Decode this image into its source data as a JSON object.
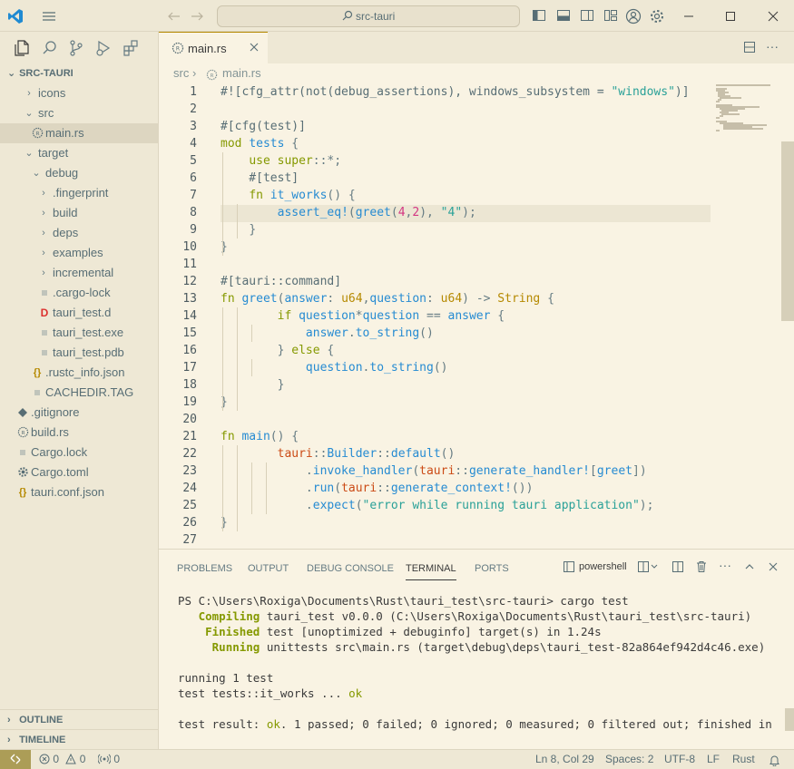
{
  "titlebar": {
    "search": "src-tauri",
    "icons": [
      "vscode-logo-icon",
      "menu-icon",
      "back-icon",
      "forward-icon",
      "toggle-primary-sidebar-icon",
      "toggle-panel-icon",
      "toggle-secondary-sidebar-icon",
      "customize-layout-icon",
      "account-icon",
      "settings-gear-icon",
      "minimize-icon",
      "maximize-icon",
      "close-icon"
    ]
  },
  "sidebar": {
    "activity_icons": [
      "explorer-icon",
      "search-icon",
      "source-control-icon",
      "run-debug-icon",
      "extensions-icon"
    ],
    "section_title": "SRC-TAURI",
    "tree": [
      {
        "label": "icons",
        "depth": 1,
        "type": "folder",
        "expanded": false
      },
      {
        "label": "src",
        "depth": 1,
        "type": "folder",
        "expanded": true
      },
      {
        "label": "main.rs",
        "depth": 2,
        "type": "rust",
        "selected": true
      },
      {
        "label": "target",
        "depth": 1,
        "type": "folder",
        "expanded": true
      },
      {
        "label": "debug",
        "depth": 2,
        "type": "folder",
        "expanded": true
      },
      {
        "label": ".fingerprint",
        "depth": 3,
        "type": "folder",
        "expanded": false
      },
      {
        "label": "build",
        "depth": 3,
        "type": "folder",
        "expanded": false
      },
      {
        "label": "deps",
        "depth": 3,
        "type": "folder",
        "expanded": false
      },
      {
        "label": "examples",
        "depth": 3,
        "type": "folder",
        "expanded": false
      },
      {
        "label": "incremental",
        "depth": 3,
        "type": "folder",
        "expanded": false
      },
      {
        "label": ".cargo-lock",
        "depth": 3,
        "type": "text"
      },
      {
        "label": "tauri_test.d",
        "depth": 3,
        "type": "d"
      },
      {
        "label": "tauri_test.exe",
        "depth": 3,
        "type": "text"
      },
      {
        "label": "tauri_test.pdb",
        "depth": 3,
        "type": "text"
      },
      {
        "label": ".rustc_info.json",
        "depth": 2,
        "type": "json"
      },
      {
        "label": "CACHEDIR.TAG",
        "depth": 2,
        "type": "text"
      },
      {
        "label": ".gitignore",
        "depth": 0,
        "type": "git"
      },
      {
        "label": "build.rs",
        "depth": 0,
        "type": "rust"
      },
      {
        "label": "Cargo.lock",
        "depth": 0,
        "type": "text"
      },
      {
        "label": "Cargo.toml",
        "depth": 0,
        "type": "gear"
      },
      {
        "label": "tauri.conf.json",
        "depth": 0,
        "type": "json"
      }
    ],
    "outline": "OUTLINE",
    "timeline": "TIMELINE"
  },
  "editor": {
    "tab_label": "main.rs",
    "breadcrumb": [
      "src",
      "main.rs"
    ],
    "line_numbers": [
      "1",
      "2",
      "3",
      "4",
      "5",
      "6",
      "7",
      "8",
      "9",
      "10",
      "11",
      "12",
      "13",
      "14",
      "15",
      "16",
      "17",
      "18",
      "19",
      "20",
      "21",
      "22",
      "23",
      "24",
      "25",
      "26",
      "27"
    ],
    "lines": [
      "#![cfg_attr(not(debug_assertions), windows_subsystem = \"windows\")]",
      "",
      "#[cfg(test)]",
      "mod tests {",
      "    use super::*;",
      "    #[test]",
      "    fn it_works() {",
      "        assert_eq!(greet(4,2), \"4\");",
      "    }",
      "}",
      "",
      "#[tauri::command]",
      "fn greet(answer: u64,question: u64) -> String {",
      "        if question*question == answer {",
      "            answer.to_string()",
      "        } else {",
      "            question.to_string()",
      "        }",
      "}",
      "",
      "fn main() {",
      "        tauri::Builder::default()",
      "            .invoke_handler(tauri::generate_handler![greet])",
      "            .run(tauri::generate_context!())",
      "            .expect(\"error while running tauri application\");",
      "}",
      ""
    ]
  },
  "panel": {
    "tabs": [
      "PROBLEMS",
      "OUTPUT",
      "DEBUG CONSOLE",
      "TERMINAL",
      "PORTS"
    ],
    "active_tab": "TERMINAL",
    "shell": "powershell",
    "terminal": {
      "prompt": "PS C:\\Users\\Roxiga\\Documents\\Rust\\tauri_test\\src-tauri> cargo test",
      "compiling_kw": "Compiling",
      "compiling": " tauri_test v0.0.0 (C:\\Users\\Roxiga\\Documents\\Rust\\tauri_test\\src-tauri)",
      "finished_kw": "Finished",
      "finished": " test [unoptimized + debuginfo] target(s) in 1.24s",
      "running_kw": "Running",
      "running": " unittests src\\main.rs (target\\debug\\deps\\tauri_test-82a864ef942d4c46.exe)",
      "running_tests": "running 1 test",
      "test_line": "test tests::it_works ... ",
      "test_ok": "ok",
      "result_pre": "test result: ",
      "result_ok": "ok",
      "result_post": ". 1 passed; 0 failed; 0 ignored; 0 measured; 0 filtered out; finished in"
    }
  },
  "statusbar": {
    "errors": "0",
    "warnings": "0",
    "ports": "0",
    "position": "Ln 8, Col 29",
    "spaces": "Spaces: 2",
    "encoding": "UTF-8",
    "eol": "LF",
    "language": "Rust"
  }
}
